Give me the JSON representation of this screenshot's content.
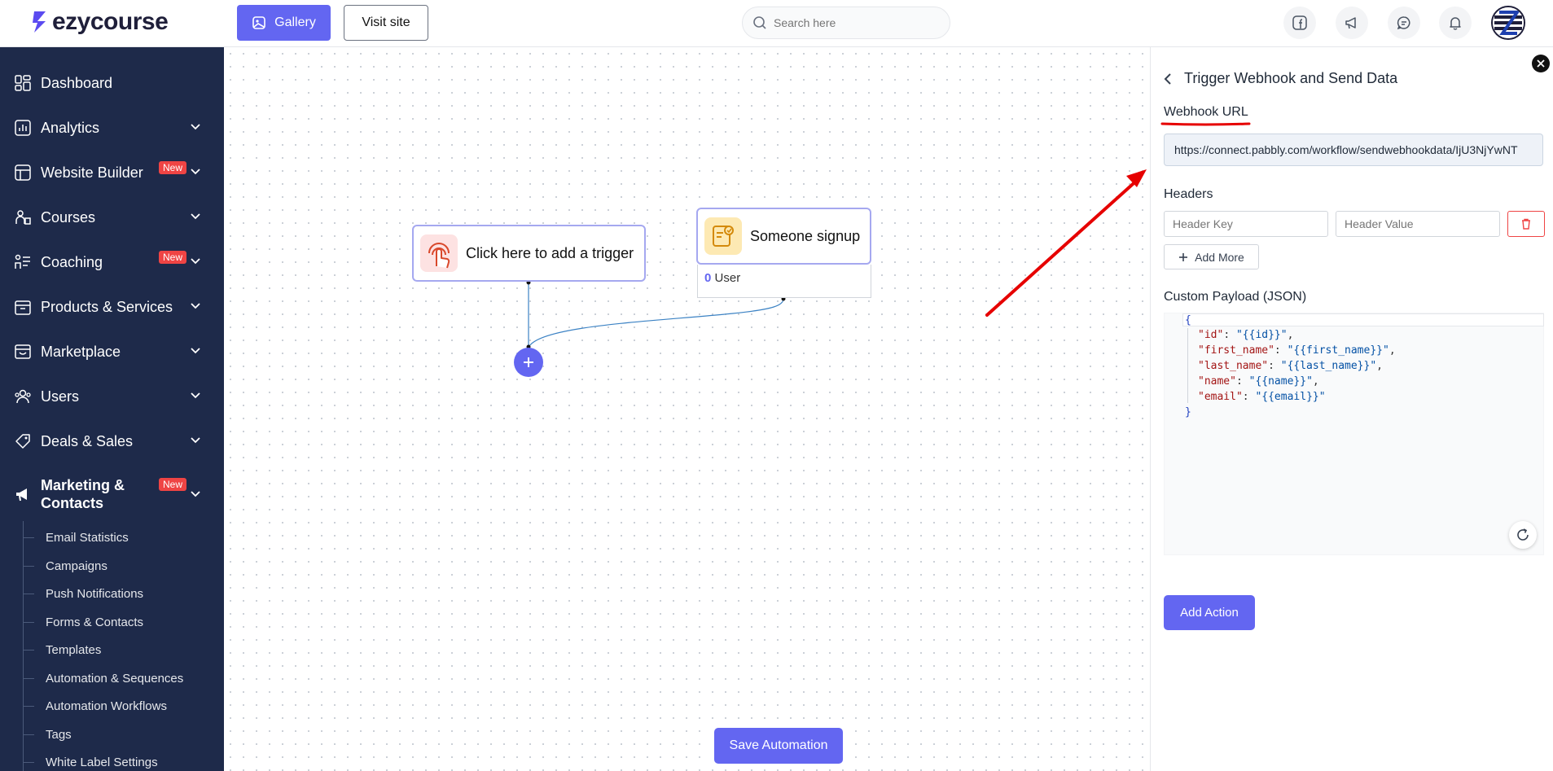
{
  "header": {
    "logo_text": "ezycourse",
    "gallery_label": "Gallery",
    "visit_site_label": "Visit site",
    "search_placeholder": "Search here"
  },
  "sidebar": {
    "items": [
      {
        "label": "Dashboard"
      },
      {
        "label": "Analytics"
      },
      {
        "label": "Website Builder",
        "badge": "New"
      },
      {
        "label": "Courses"
      },
      {
        "label": "Coaching",
        "badge": "New"
      },
      {
        "label": "Products & Services"
      },
      {
        "label": "Marketplace"
      },
      {
        "label": "Users"
      },
      {
        "label": "Deals & Sales"
      },
      {
        "label": "Marketing & Contacts",
        "badge": "New"
      }
    ],
    "marketing_line1": "Marketing &",
    "marketing_line2": "Contacts",
    "sub_items": [
      "Email Statistics",
      "Campaigns",
      "Push Notifications",
      "Forms & Contacts",
      "Templates",
      "Automation & Sequences",
      "Automation Workflows",
      "Tags",
      "White Label Settings"
    ]
  },
  "canvas": {
    "trigger_node": "Click here to add a trigger",
    "signup_node": "Someone signup",
    "user_count": "0",
    "user_label": "User",
    "save_label": "Save Automation"
  },
  "panel": {
    "title": "Trigger Webhook and Send Data",
    "webhook_label": "Webhook URL",
    "webhook_url": "https://connect.pabbly.com/workflow/sendwebhookdata/IjU3NjYwNT",
    "headers_label": "Headers",
    "header_key_placeholder": "Header Key",
    "header_value_placeholder": "Header Value",
    "add_more_label": "Add More",
    "payload_label": "Custom Payload (JSON)",
    "payload": {
      "open": "{",
      "close": "}",
      "fields": [
        {
          "key": "\"id\"",
          "value": "\"{{id}}\"",
          "sep": ","
        },
        {
          "key": "\"first_name\"",
          "value": "\"{{first_name}}\"",
          "sep": ","
        },
        {
          "key": "\"last_name\"",
          "value": "\"{{last_name}}\"",
          "sep": ","
        },
        {
          "key": "\"name\"",
          "value": "\"{{name}}\"",
          "sep": ","
        },
        {
          "key": "\"email\"",
          "value": "\"{{email}}\"",
          "sep": ""
        }
      ]
    },
    "add_action_label": "Add Action"
  },
  "colors": {
    "accent": "#6366f1",
    "sidebar_bg": "#1e2a4a",
    "badge": "#ef4444",
    "annotation": "#e60000"
  }
}
